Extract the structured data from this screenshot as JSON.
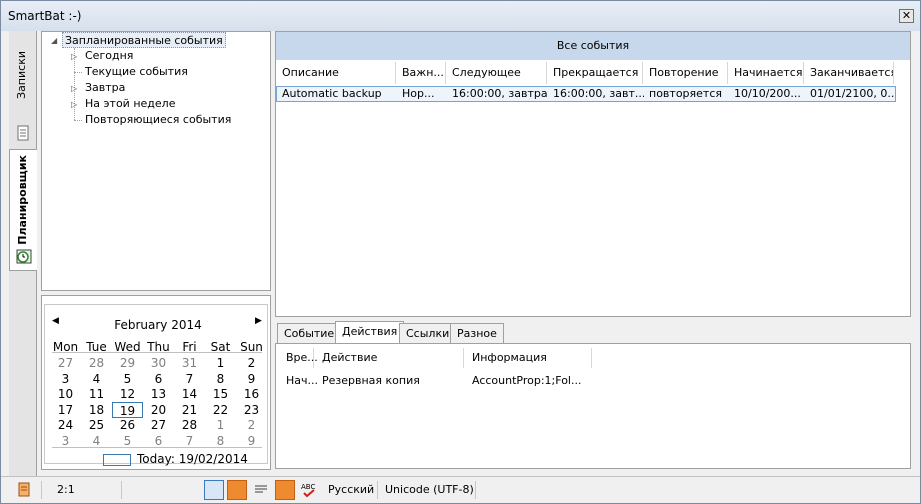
{
  "window": {
    "title": "SmartBat :-)",
    "close_glyph": "✕"
  },
  "sidebar": {
    "tabs": [
      {
        "label": "Записки",
        "icon": "notes-icon"
      },
      {
        "label": "Планировщик",
        "icon": "clock-icon",
        "active": true
      }
    ]
  },
  "tree": {
    "root": "Запланированные события",
    "items": [
      {
        "label": "Сегодня",
        "expandable": true
      },
      {
        "label": "Текущие события",
        "expandable": false
      },
      {
        "label": "Завтра",
        "expandable": true
      },
      {
        "label": "На этой неделе",
        "expandable": true
      },
      {
        "label": "Повторяющиеся события",
        "expandable": false
      }
    ]
  },
  "calendar": {
    "month": "February 2014",
    "prev": "◀",
    "next": "▶",
    "weekdays": [
      "Mon",
      "Tue",
      "Wed",
      "Thu",
      "Fri",
      "Sat",
      "Sun"
    ],
    "weeks": [
      [
        "27",
        "28",
        "29",
        "30",
        "31",
        "1",
        "2"
      ],
      [
        "3",
        "4",
        "5",
        "6",
        "7",
        "8",
        "9"
      ],
      [
        "10",
        "11",
        "12",
        "13",
        "14",
        "15",
        "16"
      ],
      [
        "17",
        "18",
        "19",
        "20",
        "21",
        "22",
        "23"
      ],
      [
        "24",
        "25",
        "26",
        "27",
        "28",
        "1",
        "2"
      ],
      [
        "3",
        "4",
        "5",
        "6",
        "7",
        "8",
        "9"
      ]
    ],
    "today_label": "Today: 19/02/2014"
  },
  "events": {
    "header": "Все события",
    "columns": [
      "Описание",
      "Важн...",
      "Следующее",
      "Прекращается",
      "Повторение",
      "Начинается",
      "Заканчивается"
    ],
    "rows": [
      [
        "Automatic backup",
        "Нор...",
        "16:00:00, завтра",
        "16:00:00, завт...",
        "повторяется",
        "10/10/200...",
        "01/01/2100, 0..."
      ]
    ]
  },
  "details": {
    "tabs": [
      "Событие",
      "Действия",
      "Ссылки",
      "Разное"
    ],
    "active_tab": "Действия",
    "columns": [
      "Вре...",
      "Действие",
      "Информация"
    ],
    "rows": [
      [
        "Нач...",
        "Резервная копия",
        "AccountProp:1;Fol..."
      ]
    ]
  },
  "statusbar": {
    "position": "2:1",
    "language": "Русский",
    "encoding": "Unicode (UTF-8)"
  },
  "colors": {
    "accent": "#c8d8ec",
    "selection_border": "#7aa2d0",
    "orange": "#f08a30"
  }
}
